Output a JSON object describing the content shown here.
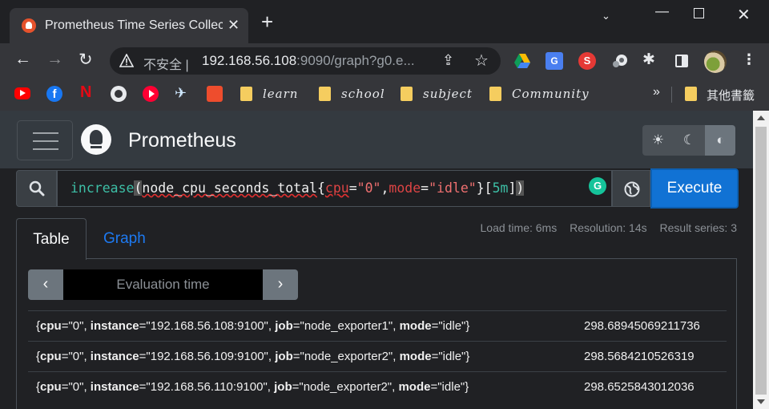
{
  "browser": {
    "tab_title": "Prometheus Time Series Collect",
    "tab_close": "✕",
    "new_tab": "+",
    "window_controls": {
      "dropdown": "⌄",
      "minimize": "—",
      "close": "✕"
    },
    "nav": {
      "back": "←",
      "forward": "→",
      "reload": "↻"
    },
    "security_label": "不安全",
    "url_host": "192.168.56.108",
    "url_rest": ":9090/graph?g0.e...",
    "extensions": {
      "translate": "G",
      "s_ext": "S",
      "fb": "f",
      "netflix": "N"
    },
    "bookmarks": [
      "learn",
      "school",
      "subject",
      "Community"
    ],
    "bookmarks_more": "»",
    "other_bookmarks": "其他書籤"
  },
  "app": {
    "brand": "Prometheus",
    "theme_buttons": [
      "☀",
      "☾",
      "◐"
    ],
    "query": {
      "fn": "increase",
      "open_paren": "(",
      "metric": "node_cpu_seconds_total",
      "brace_open": "{",
      "label1": "cpu",
      "eq1": "=",
      "val1": "\"0\"",
      "comma": ",",
      "label2": "mode",
      "eq2": "=",
      "val2": "\"idle\"",
      "brace_close": "}",
      "range_open": "[",
      "duration": "5m",
      "range_close": "]",
      "close_paren": ")"
    },
    "execute_label": "Execute",
    "tabs": {
      "table": "Table",
      "graph": "Graph"
    },
    "stats": {
      "load_time": "Load time: 6ms",
      "resolution": "Resolution: 14s",
      "result_series": "Result series: 3"
    },
    "eval_placeholder": "Evaluation time",
    "eval_prev": "‹",
    "eval_next": "›",
    "results": [
      {
        "cpu": "\"0\"",
        "instance": "\"192.168.56.108:9100\"",
        "job": "\"node_exporter1\"",
        "mode": "\"idle\"",
        "value": "298.68945069211736"
      },
      {
        "cpu": "\"0\"",
        "instance": "\"192.168.56.109:9100\"",
        "job": "\"node_exporter2\"",
        "mode": "\"idle\"",
        "value": "298.5684210526319"
      },
      {
        "cpu": "\"0\"",
        "instance": "\"192.168.56.110:9100\"",
        "job": "\"node_exporter2\"",
        "mode": "\"idle\"",
        "value": "298.6525843012036"
      }
    ]
  }
}
